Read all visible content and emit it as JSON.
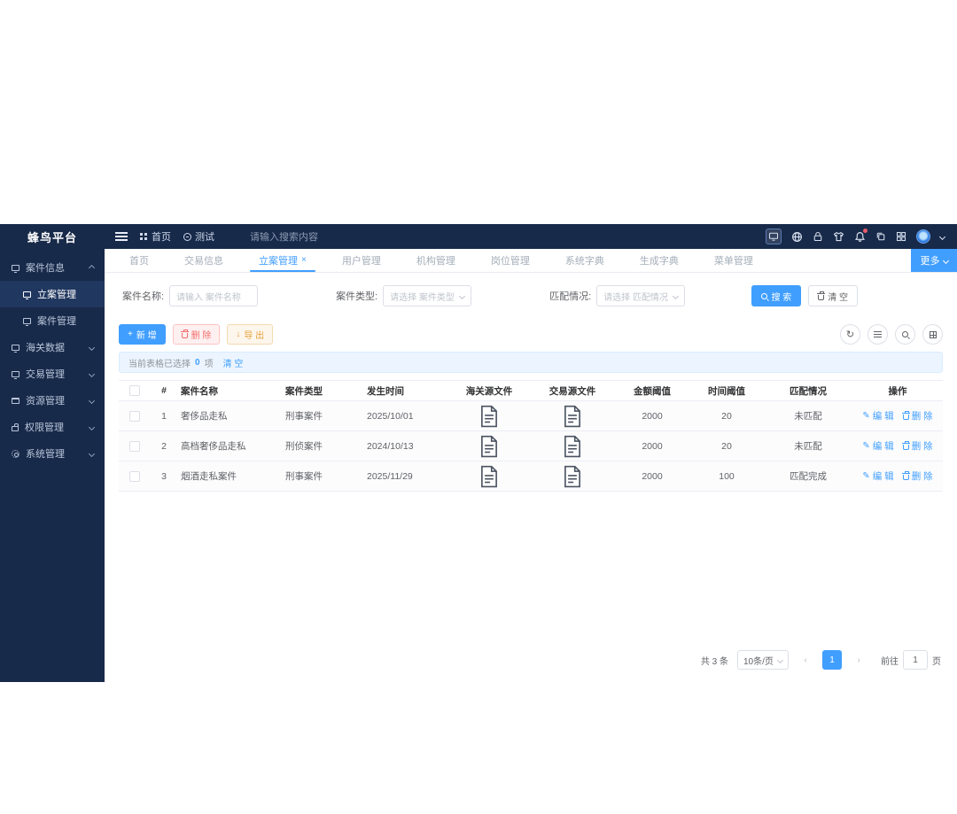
{
  "colors": {
    "accent": "#409eff",
    "navy": "#182a4a",
    "danger": "#f56c6c",
    "warning": "#e6a23c"
  },
  "brand": {
    "title": "蜂鸟平台"
  },
  "topbar": {
    "breadcrumb": {
      "home": "首页",
      "test": "测试"
    },
    "search_placeholder": "请输入搜索内容",
    "icons": [
      "monitor-icon",
      "globe-icon",
      "lock-icon",
      "theme-shirt-icon",
      "bell-icon",
      "copy-icon",
      "grid-icon",
      "avatar",
      "chevron-down-icon"
    ]
  },
  "sidebar": {
    "items": [
      {
        "label": "案件信息",
        "icon": "monitor-icon",
        "expanded": true,
        "collapsible": true
      },
      {
        "label": "立案管理",
        "icon": "monitor-icon",
        "child": true,
        "active": true
      },
      {
        "label": "案件管理",
        "icon": "monitor-icon",
        "child": true
      },
      {
        "label": "海关数据",
        "icon": "monitor-icon",
        "collapsible": true,
        "collapsed": true
      },
      {
        "label": "交易管理",
        "icon": "monitor-icon",
        "collapsible": true,
        "collapsed": true
      },
      {
        "label": "资源管理",
        "icon": "box-icon",
        "collapsible": true,
        "collapsed": true
      },
      {
        "label": "权限管理",
        "icon": "lock-icon",
        "collapsible": true,
        "collapsed": true
      },
      {
        "label": "系统管理",
        "icon": "gear-icon",
        "collapsible": true,
        "collapsed": true
      }
    ]
  },
  "tabbar": {
    "tabs": [
      {
        "label": "首页"
      },
      {
        "label": "交易信息"
      },
      {
        "label": "立案管理",
        "active": true,
        "closable": true,
        "close_glyph": "×"
      },
      {
        "label": "用户管理"
      },
      {
        "label": "机构管理"
      },
      {
        "label": "岗位管理"
      },
      {
        "label": "系统字典"
      },
      {
        "label": "生成字典"
      },
      {
        "label": "菜单管理"
      }
    ],
    "more_label": "更多"
  },
  "filter": {
    "name_label": "案件名称:",
    "name_placeholder": "请输入 案件名称",
    "type_label": "案件类型:",
    "type_placeholder": "请选择 案件类型",
    "match_label": "匹配情况:",
    "match_placeholder": "请选择 匹配情况",
    "search_label": "搜 索",
    "reset_label": "清 空"
  },
  "toolbar": {
    "add_label": "新 增",
    "delete_label": "删 除",
    "export_label": "导 出",
    "add_glyph": "+",
    "export_glyph": "↓"
  },
  "selection": {
    "prefix": "当前表格已选择",
    "count": "0",
    "unit": "项",
    "clear_label": "清 空"
  },
  "table": {
    "columns": {
      "index": "#",
      "name": "案件名称",
      "type": "案件类型",
      "date": "发生时间",
      "customs_file": "海关源文件",
      "trade_file": "交易源文件",
      "amount": "金额阈值",
      "time": "时间阈值",
      "match": "匹配情况",
      "ops": "操作"
    },
    "edit_label": "编 辑",
    "delete_label": "删 除",
    "edit_glyph": "✎",
    "rows": [
      {
        "index": "1",
        "name": "奢侈品走私",
        "type": "刑事案件",
        "date": "2025/10/01",
        "amount": "2000",
        "time": "20",
        "status": "未匹配"
      },
      {
        "index": "2",
        "name": "高档奢侈品走私",
        "type": "刑侦案件",
        "date": "2024/10/13",
        "amount": "2000",
        "time": "20",
        "status": "未匹配"
      },
      {
        "index": "3",
        "name": "烟酒走私案件",
        "type": "刑事案件",
        "date": "2025/11/29",
        "amount": "2000",
        "time": "100",
        "status": "匹配完成"
      }
    ]
  },
  "pagination": {
    "total": "共 3 条",
    "page_size": "10条/页",
    "prev": "‹",
    "next": "›",
    "current_page": "1",
    "goto_label": "前往",
    "goto_value": "1",
    "goto_unit": "页"
  }
}
